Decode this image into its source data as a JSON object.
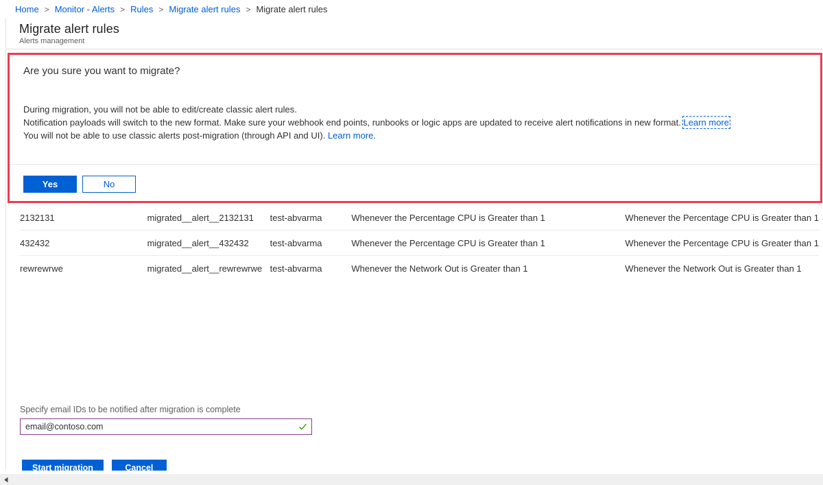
{
  "breadcrumb": {
    "items": [
      {
        "label": "Home",
        "link": true
      },
      {
        "label": "Monitor - Alerts",
        "link": true
      },
      {
        "label": "Rules",
        "link": true
      },
      {
        "label": "Migrate alert rules",
        "link": true
      },
      {
        "label": "Migrate alert rules",
        "link": false
      }
    ],
    "separator": ">"
  },
  "blade": {
    "title": "Migrate alert rules",
    "subtitle": "Alerts management"
  },
  "confirm": {
    "question": "Are you sure you want to migrate?",
    "line1": "During migration, you will not be able to edit/create classic alert rules.",
    "line2_text": "Notification payloads will switch to the new format. Make sure your webhook end points, runbooks or logic apps are updated to receive alert notifications in new format.",
    "line2_link": "Learn more",
    "line3_text": "You will not be able to use classic alerts post-migration (through API and UI).",
    "line3_link": "Learn more.",
    "yes_label": "Yes",
    "no_label": "No",
    "border_color": "#ef3a4f"
  },
  "table": {
    "rows": [
      {
        "name": "2132131",
        "new_name": "migrated__alert__2132131",
        "resource_group": "test-abvarma",
        "condition": "Whenever the Percentage CPU is Greater than 1",
        "new_condition": "Whenever the Percentage CPU is Greater than 1"
      },
      {
        "name": "432432",
        "new_name": "migrated__alert__432432",
        "resource_group": "test-abvarma",
        "condition": "Whenever the Percentage CPU is Greater than 1",
        "new_condition": "Whenever the Percentage CPU is Greater than 1"
      },
      {
        "name": "rewrewrwe",
        "new_name": "migrated__alert__rewrewrwe",
        "resource_group": "test-abvarma",
        "condition": "Whenever the Network Out is Greater than 1",
        "new_condition": "Whenever the Network Out is Greater than 1"
      }
    ]
  },
  "email": {
    "label": "Specify email IDs to be notified after migration is complete",
    "value": "email@contoso.com",
    "placeholder": "email@contoso.com",
    "valid_icon": "check-icon",
    "valid_color": "#3aa103",
    "border_color": "#8a3a8a"
  },
  "footer": {
    "start_label": "Start migration",
    "cancel_label": "Cancel"
  },
  "scrollbar": {
    "left_arrow_icon": "caret-left-icon"
  },
  "colors": {
    "accent": "#0061d5",
    "link": "#015cda",
    "danger": "#ef3a4f"
  }
}
